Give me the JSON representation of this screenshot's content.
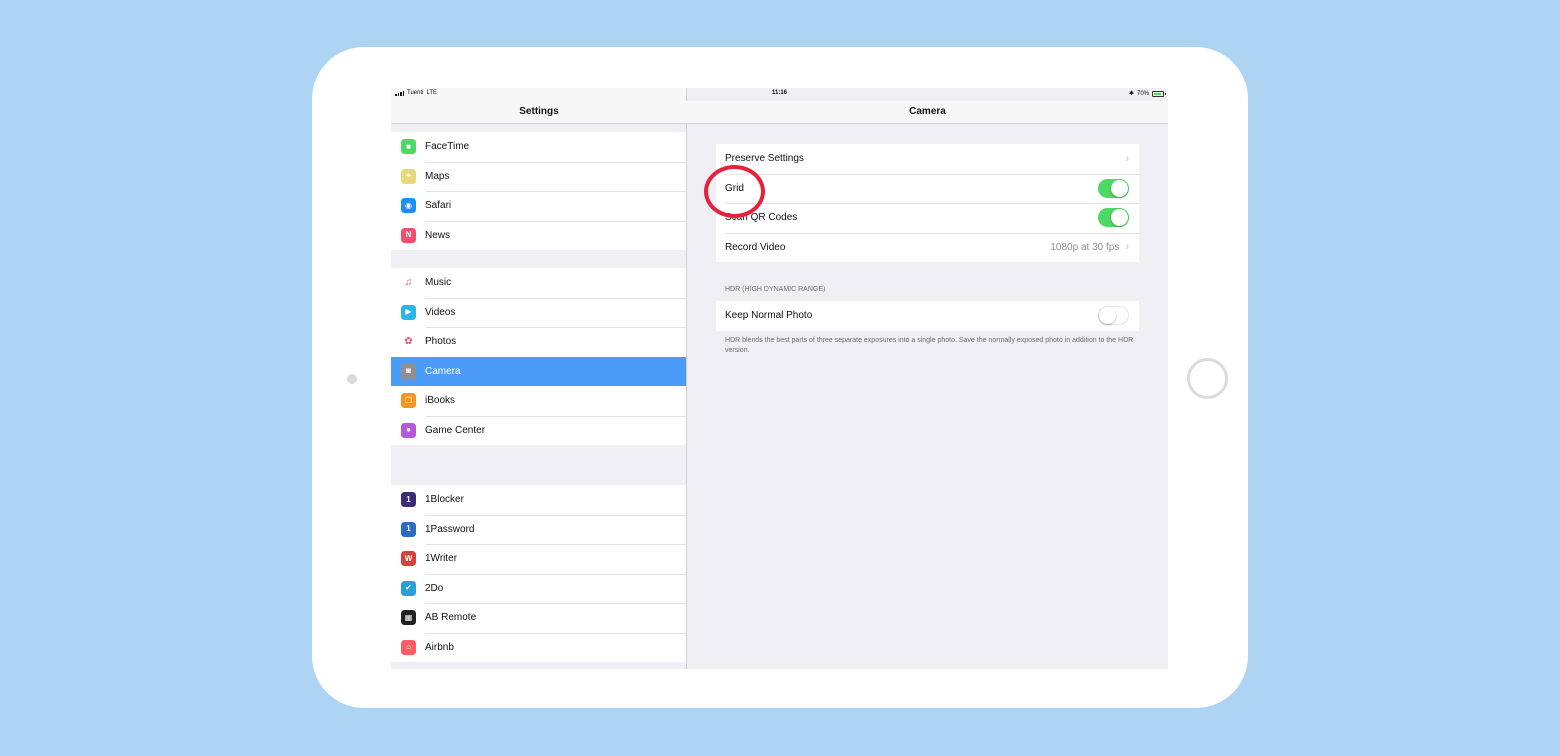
{
  "status_bar": {
    "carrier": "Tuenti",
    "network": "LTE",
    "time": "11:16",
    "bluetooth": "✱",
    "battery": "70%"
  },
  "master": {
    "title": "Settings",
    "groups": [
      {
        "items": [
          {
            "label": "FaceTime",
            "icon": "facetime-icon",
            "color": "#4cd964",
            "glyph": "■"
          },
          {
            "label": "Maps",
            "icon": "maps-icon",
            "color": "#e9d87c",
            "glyph": "⌖"
          },
          {
            "label": "Safari",
            "icon": "safari-icon",
            "color": "#1e8ef5",
            "glyph": "◉"
          },
          {
            "label": "News",
            "icon": "news-icon",
            "color": "#f0506e",
            "glyph": "N"
          }
        ]
      },
      {
        "items": [
          {
            "label": "Music",
            "icon": "music-icon",
            "color": "#ffffff",
            "glyph": "♫"
          },
          {
            "label": "Videos",
            "icon": "videos-icon",
            "color": "#29b6e6",
            "glyph": "▶"
          },
          {
            "label": "Photos",
            "icon": "photos-icon",
            "color": "#ffffff",
            "glyph": "✿"
          },
          {
            "label": "Camera",
            "icon": "camera-icon",
            "color": "#8e8e93",
            "glyph": "◙",
            "selected": true
          },
          {
            "label": "iBooks",
            "icon": "ibooks-icon",
            "color": "#f5941e",
            "glyph": "❐"
          },
          {
            "label": "Game Center",
            "icon": "game-center-icon",
            "color": "#b45ad9",
            "glyph": "●"
          }
        ]
      },
      {
        "items": [
          {
            "label": "1Blocker",
            "icon": "1blocker-icon",
            "color": "#3a2c7a",
            "glyph": "1"
          },
          {
            "label": "1Password",
            "icon": "1password-icon",
            "color": "#2d6bc0",
            "glyph": "1"
          },
          {
            "label": "1Writer",
            "icon": "1writer-icon",
            "color": "#d8403b",
            "glyph": "W"
          },
          {
            "label": "2Do",
            "icon": "2do-icon",
            "color": "#2a9fd8",
            "glyph": "✔"
          },
          {
            "label": "AB Remote",
            "icon": "ab-remote-icon",
            "color": "#222222",
            "glyph": "▦"
          },
          {
            "label": "Airbnb",
            "icon": "airbnb-icon",
            "color": "#fd5c63",
            "glyph": "⌂"
          }
        ]
      }
    ]
  },
  "detail": {
    "title": "Camera",
    "rows": [
      {
        "label": "Preserve Settings",
        "type": "nav"
      },
      {
        "label": "Grid",
        "type": "toggle",
        "on": true
      },
      {
        "label": "Scan QR Codes",
        "type": "toggle",
        "on": true
      },
      {
        "label": "Record Video",
        "type": "nav",
        "value": "1080p at 30 fps"
      }
    ],
    "hdr_header": "HDR (HIGH DYNAMIC RANGE)",
    "hdr_rows": [
      {
        "label": "Keep Normal Photo",
        "type": "toggle",
        "on": false
      }
    ],
    "hdr_footer": "HDR blends the best parts of three separate exposures into a single photo. Save the normally exposed photo in addition to the HDR version."
  },
  "colors": {
    "background": "#add5f3",
    "selection": "#4b9cf9",
    "toggle_on": "#4cd964",
    "annotation": "#e7213b"
  }
}
